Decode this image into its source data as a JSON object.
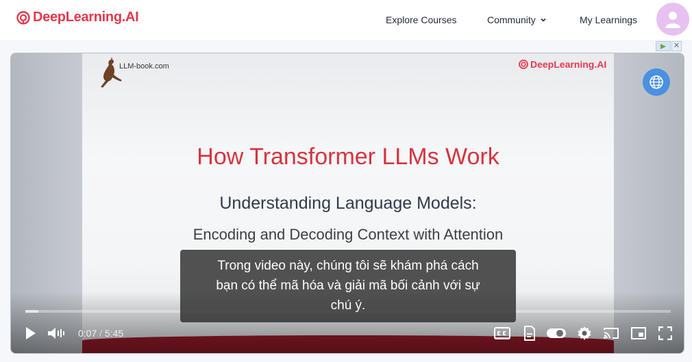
{
  "brand": {
    "name": "DeepLearning.AI",
    "color": "#e3394a"
  },
  "nav": {
    "explore_courses": "Explore Courses",
    "community": "Community",
    "my_learnings": "My Learnings"
  },
  "icons": {
    "logo": "deeplearning-logo-icon",
    "chevron": "chevron-down-icon",
    "avatar": "user-avatar-icon",
    "globe": "globe-icon",
    "play": "play-icon",
    "volume": "volume-icon",
    "captions": "captions-icon",
    "transcript": "transcript-icon",
    "autoplay": "autoplay-toggle-icon",
    "settings": "gear-icon",
    "cast": "cast-icon",
    "miniplayer": "miniplayer-icon",
    "fullscreen": "fullscreen-icon"
  },
  "video": {
    "watermark_site": "LLM-book.com",
    "watermark_brand": "DeepLearning.AI",
    "slide_title": "How Transformer LLMs Work",
    "slide_subtitle": "Understanding Language Models:",
    "slide_subtitle2": "Encoding and Decoding Context with Attention",
    "caption_lines": [
      "Trong video này, chúng tôi sẽ khám phá cách",
      "bạn có thể mã hóa và giải mã bối cảnh với sự",
      "chú ý."
    ],
    "current_time": "0:07",
    "time_separator": "/",
    "duration": "5:45",
    "progress": 0.02
  }
}
